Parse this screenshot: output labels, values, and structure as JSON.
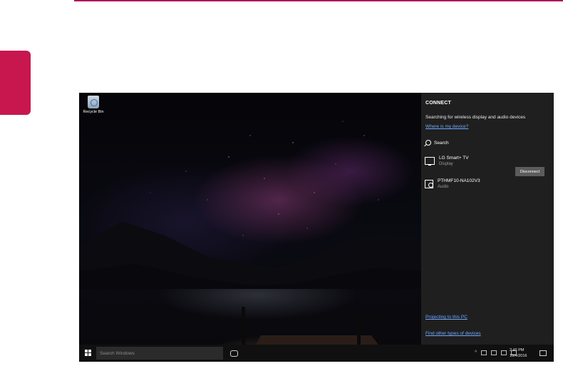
{
  "desktop": {
    "recycle_bin_label": "Recycle Bin"
  },
  "connect_panel": {
    "title": "CONNECT",
    "status": "Searching for wireless display and audio devices",
    "where_link": "Where is my device?",
    "search_label": "Search",
    "devices": [
      {
        "name": "LG Smart+ TV",
        "type": "Display",
        "icon": "monitor-icon"
      },
      {
        "name": "PTHMF10-NA102V3",
        "type": "Audio",
        "icon": "audio-device-icon"
      }
    ],
    "disconnect_label": "Disconnect",
    "projecting_link": "Projecting to this PC",
    "other_devices_link": "Find other types of devices"
  },
  "taskbar": {
    "search_placeholder": "Search Windows",
    "time": "2:45 PM",
    "date": "10/4/2016"
  },
  "colors": {
    "accent": "#c8174f",
    "rule": "#b0175a",
    "panel_bg": "#1f1f1f",
    "link": "#6ea8ff"
  }
}
